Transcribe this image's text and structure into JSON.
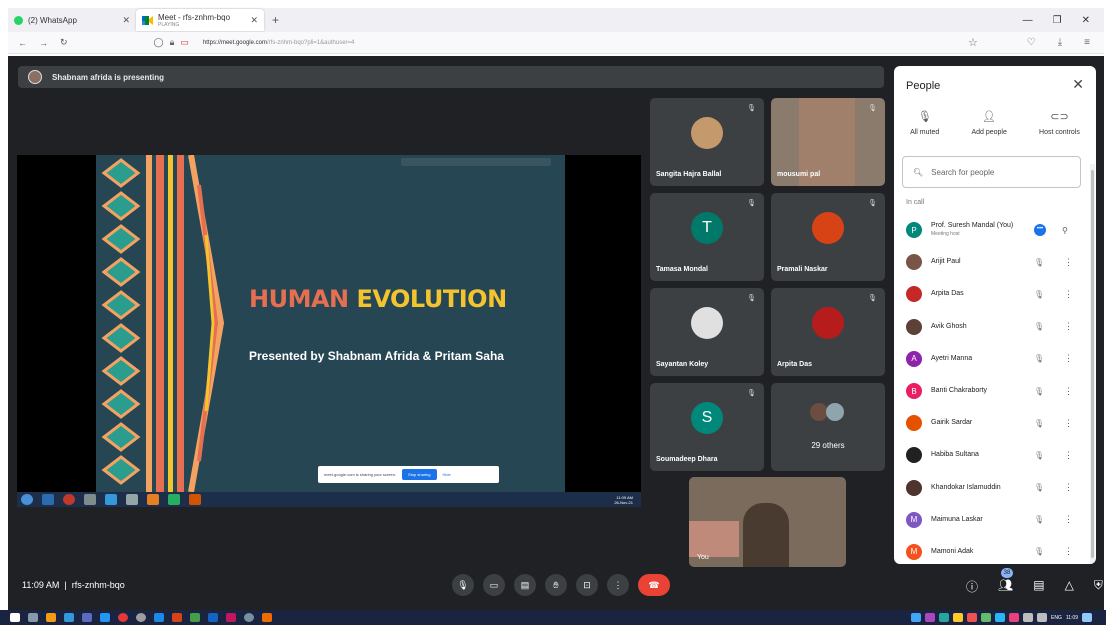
{
  "browser": {
    "tabs": [
      {
        "title": "(2) WhatsApp",
        "subtitle": ""
      },
      {
        "title": "Meet - rfs-znhm-bqo",
        "subtitle": "PLAYING"
      }
    ],
    "url_host": "https://meet.google.com",
    "url_path": "/rfs-znhm-bqo?pli=1&authuser=4"
  },
  "meet": {
    "presenting_text": "Shabnam afrida is presenting",
    "slide": {
      "title_part1": "HUMAN ",
      "title_part2": "EVOLUTION",
      "subtitle": "Presented by Shabnam Afrida & Pritam Saha",
      "share_notice": "meet.google.com is sharing your screen.",
      "stop_sharing": "Stop sharing",
      "hide": "Hide",
      "clock_time": "11:09 AM",
      "clock_date": "26-Nov-21"
    },
    "tiles": [
      {
        "name": "Sangita Hajra Ballal",
        "initial": "",
        "color": "#c49a6c"
      },
      {
        "name": "mousumi pal",
        "initial": "",
        "color": "#8b5a2b"
      },
      {
        "name": "Tamasa Mondal",
        "initial": "T",
        "color": "#00796b"
      },
      {
        "name": "Pramali Naskar",
        "initial": "",
        "color": "#d84315"
      },
      {
        "name": "Sayantan Koley",
        "initial": "",
        "color": "#e0e0e0"
      },
      {
        "name": "Arpita Das",
        "initial": "",
        "color": "#b71c1c"
      },
      {
        "name": "Soumadeep Dhara",
        "initial": "S",
        "color": "#00897b"
      }
    ],
    "others_count": "29 others",
    "self_label": "You",
    "clock": "11:09 AM",
    "meeting_code": "rfs-znhm-bqo",
    "people_badge": "38"
  },
  "panel": {
    "title": "People",
    "actions": [
      {
        "label": "All muted",
        "icon": "mic-off-icon"
      },
      {
        "label": "Add people",
        "icon": "add-person-icon"
      },
      {
        "label": "Host controls",
        "icon": "host-controls-icon"
      }
    ],
    "search_placeholder": "Search for people",
    "section_label": "In call",
    "participants": [
      {
        "name": "Prof. Suresh Mandal (You)",
        "role": "Meeting host",
        "initial": "P",
        "color": "#00897b",
        "host": true
      },
      {
        "name": "Arijit Paul",
        "role": "",
        "initial": "",
        "color": "#795548",
        "host": false
      },
      {
        "name": "Arpita Das",
        "role": "",
        "initial": "",
        "color": "#c62828",
        "host": false
      },
      {
        "name": "Avik Ghosh",
        "role": "",
        "initial": "",
        "color": "#5d4037",
        "host": false
      },
      {
        "name": "Ayetri Manna",
        "role": "",
        "initial": "A",
        "color": "#8e24aa",
        "host": false
      },
      {
        "name": "Banti Chakraborty",
        "role": "",
        "initial": "B",
        "color": "#e91e63",
        "host": false
      },
      {
        "name": "Gairik Sardar",
        "role": "",
        "initial": "",
        "color": "#e65100",
        "host": false
      },
      {
        "name": "Habiba Sultana",
        "role": "",
        "initial": "",
        "color": "#212121",
        "host": false
      },
      {
        "name": "Khandokar Islamuddin",
        "role": "",
        "initial": "",
        "color": "#4e342e",
        "host": false
      },
      {
        "name": "Maimuna Laskar",
        "role": "",
        "initial": "M",
        "color": "#7e57c2",
        "host": false
      },
      {
        "name": "Mamoni Adak",
        "role": "",
        "initial": "M",
        "color": "#f4511e",
        "host": false
      }
    ]
  },
  "os": {
    "lang": "ENG",
    "time": "11:09"
  }
}
